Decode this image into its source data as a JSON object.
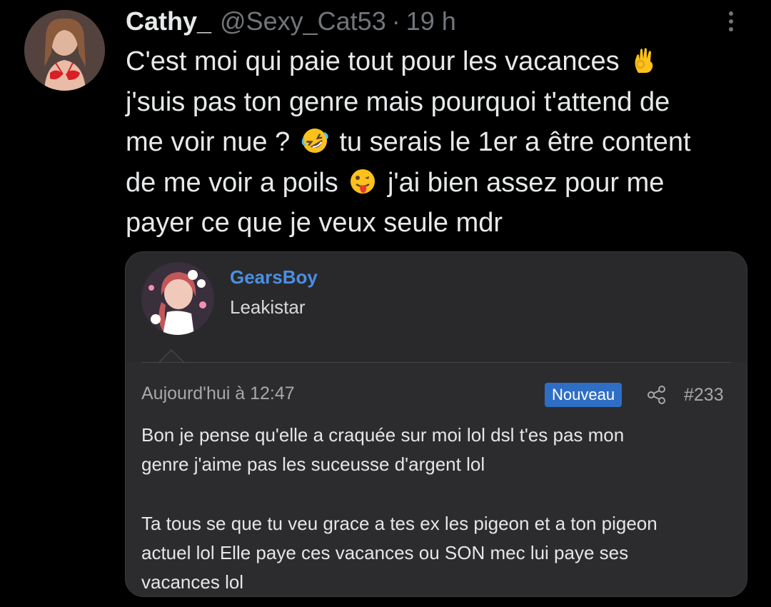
{
  "tweet": {
    "display_name": "Cathy_",
    "handle": "@Sexy_Cat53",
    "separator": "·",
    "time": "19 h",
    "lines": [
      {
        "before": "C'est moi qui paie tout pour les vacances",
        "emoji": "ok-hand-emoji",
        "after": ""
      },
      {
        "before": "j'suis pas ton genre mais pourquoi t'attend de",
        "emoji": "",
        "after": ""
      },
      {
        "before": "me voir nue ?",
        "emoji": "rolling-laughing-emoji",
        "after": "tu serais le 1er a être content"
      },
      {
        "before": "de me voir a poils",
        "emoji": "winking-tongue-emoji",
        "after": "j'ai bien assez pour me"
      },
      {
        "before": "payer ce que je veux seule mdr",
        "emoji": "",
        "after": ""
      }
    ]
  },
  "embedded_post": {
    "username": "GearsBoy",
    "role": "Leakistar",
    "date": "Aujourd'hui à 12:47",
    "badge": "Nouveau",
    "post_number": "#233",
    "paragraph1_lines": [
      "Bon je pense qu'elle a craquée sur moi lol dsl t'es pas mon",
      "genre j'aime pas les suceusse d'argent lol"
    ],
    "paragraph2_lines": [
      "Ta tous se que tu veu grace a tes ex les pigeon et a ton pigeon",
      "actuel lol Elle paye ces vacances ou SON mec lui paye ses",
      "vacances lol"
    ]
  },
  "icons": [
    "more-options-icon",
    "share-icon"
  ],
  "colors": {
    "background": "#000000",
    "text": "#e7e9ea",
    "muted": "#71767b",
    "card_background": "#2c2c2f",
    "username_blue": "#4a90e2",
    "badge_blue": "#2f6ec5"
  }
}
